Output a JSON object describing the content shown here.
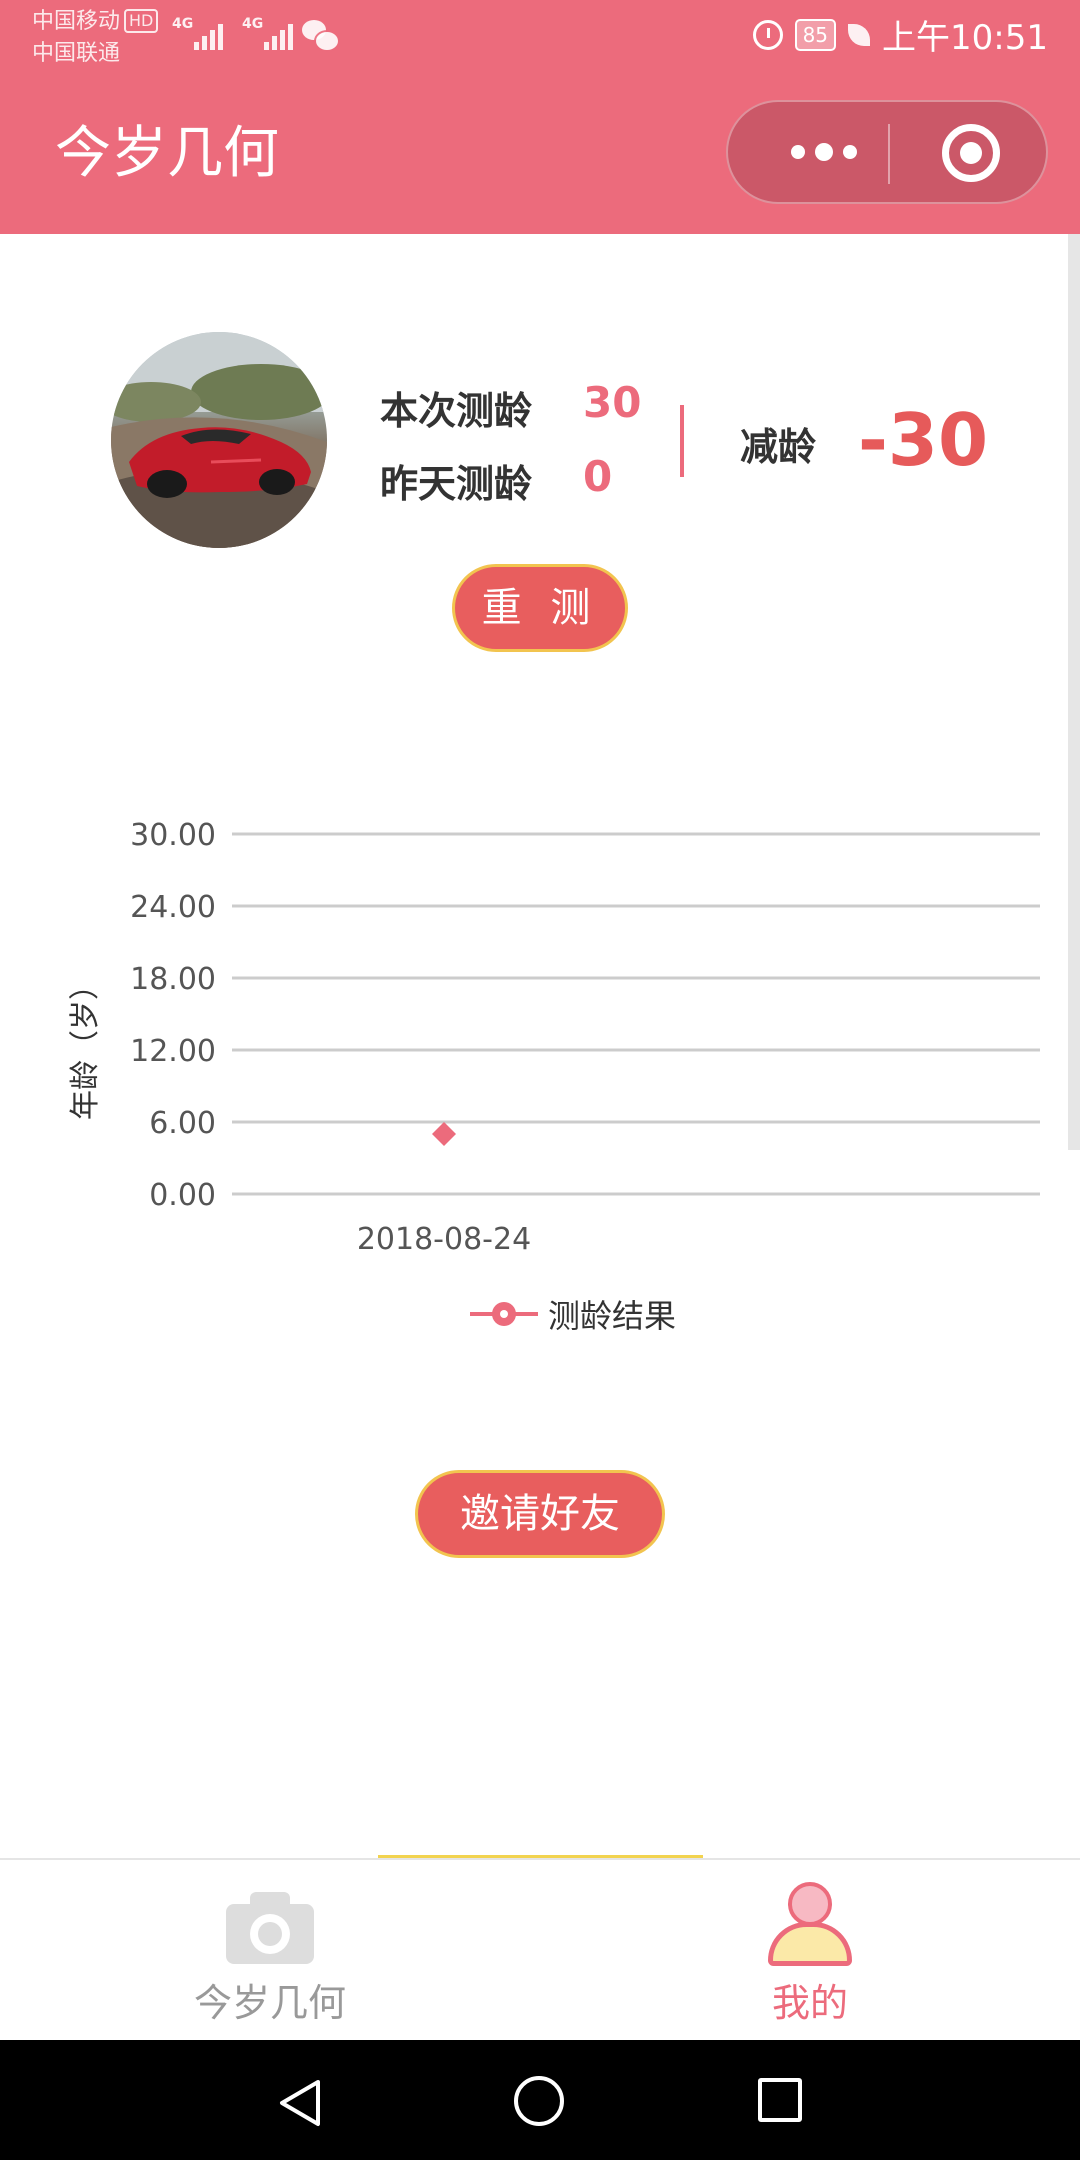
{
  "status_bar": {
    "carrier1": "中国移动",
    "carrier1_badge": "HD",
    "carrier2": "中国联通",
    "network1": "4G",
    "network2": "4G",
    "battery": "85",
    "time": "上午10:51"
  },
  "header": {
    "title": "今岁几何",
    "more_icon": "more-dots-icon",
    "close_icon": "target-close-icon"
  },
  "profile": {
    "avatar_icon": "car-photo",
    "current_label": "本次测龄",
    "current_value": "30",
    "yesterday_label": "昨天测龄",
    "yesterday_value": "0",
    "reduce_label": "减龄",
    "reduce_value": "-30",
    "retest_button": "重 测"
  },
  "chart_data": {
    "type": "scatter",
    "ylabel": "年龄（岁）",
    "xlabel": "",
    "categories": [
      "2018-08-24"
    ],
    "series": [
      {
        "name": "测龄结果",
        "values": [
          5
        ],
        "color": "#ec6b7c",
        "marker": "diamond"
      }
    ],
    "yticks": [
      "30.00",
      "24.00",
      "18.00",
      "12.00",
      "6.00",
      "0.00"
    ],
    "ylim": [
      0,
      30
    ],
    "grid": true,
    "legend": "bottom-center"
  },
  "invite_button": "邀请好友",
  "tabbar": {
    "items": [
      {
        "label": "今岁几何",
        "icon": "camera-icon",
        "active": false
      },
      {
        "label": "我的",
        "icon": "person-icon",
        "active": true
      }
    ]
  },
  "colors": {
    "primary": "#ec6b7c",
    "button": "#e85e5e",
    "button_border": "#f2c44f",
    "accent_red": "#e65a5a"
  },
  "navbar": {
    "icons": [
      "back-icon",
      "home-icon",
      "recent-apps-icon"
    ]
  }
}
